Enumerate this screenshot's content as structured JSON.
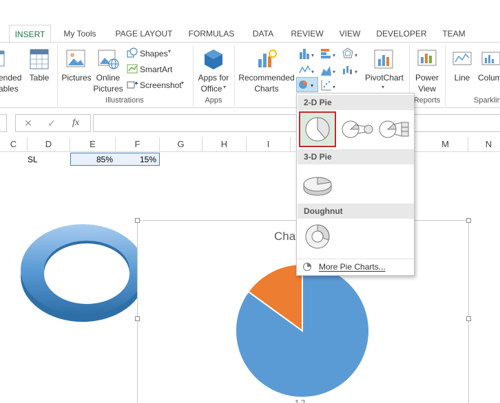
{
  "tabs": [
    {
      "label": "INSERT"
    },
    {
      "label": "My Tools"
    },
    {
      "label": "PAGE LAYOUT"
    },
    {
      "label": "FORMULAS"
    },
    {
      "label": "DATA"
    },
    {
      "label": "REVIEW"
    },
    {
      "label": "VIEW"
    },
    {
      "label": "DEVELOPER"
    },
    {
      "label": "TEAM"
    }
  ],
  "ribbon": {
    "recommended_tables_1": "ended",
    "recommended_tables_2": "ables",
    "table": "Table",
    "pictures": "Pictures",
    "online_pictures_1": "Online",
    "online_pictures_2": "Pictures",
    "shapes": "Shapes",
    "smartart": "SmartArt",
    "screenshot": "Screenshot",
    "apps_for_office_1": "Apps for",
    "apps_for_office_2": "Office",
    "recommended_charts_1": "Recommended",
    "recommended_charts_2": "Charts",
    "pivotchart": "PivotChart",
    "power_view_1": "Power",
    "power_view_2": "View",
    "line": "Line",
    "column": "Colum",
    "groups": {
      "illustrations": "Illustrations",
      "apps": "Apps",
      "reports": "Reports",
      "sparklines": "Sparklin"
    }
  },
  "formula_bar": {
    "cancel": "✕",
    "enter": "✓",
    "fx": "fx",
    "value": ""
  },
  "columns": [
    "C",
    "D",
    "E",
    "F",
    "G",
    "H",
    "I",
    "M",
    "N"
  ],
  "cells": {
    "d1": "SL",
    "e1": "85%",
    "f1": "15%"
  },
  "chart": {
    "title_partial": "Cha",
    "axis_partial": "1  2"
  },
  "chart_data": {
    "type": "pie",
    "categories": [
      "1",
      "2"
    ],
    "values": [
      85,
      15
    ],
    "colors": [
      "#5b9bd5",
      "#ed7d31"
    ],
    "title": "Cha"
  },
  "pie_menu": {
    "section_2d": "2-D Pie",
    "section_3d": "3-D Pie",
    "section_doughnut": "Doughnut",
    "more": "More Pie Charts..."
  },
  "colors": {
    "accent_green": "#217346",
    "pie_blue": "#5b9bd5",
    "pie_orange": "#ed7d31",
    "highlight_red": "#c0282d",
    "selection_border": "#4a7ebb"
  }
}
